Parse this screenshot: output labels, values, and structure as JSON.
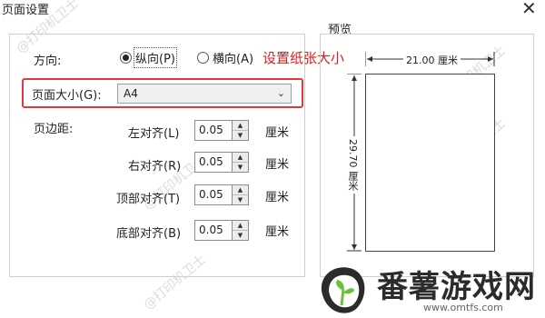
{
  "window": {
    "title": "页面设置"
  },
  "orientation": {
    "label": "方向:",
    "portrait": "纵向(P)",
    "landscape": "横向(A)",
    "selected": "portrait"
  },
  "annotation": "设置纸张大小",
  "page_size": {
    "label": "页面大小(G):",
    "value": "A4"
  },
  "margins": {
    "label": "页边距:",
    "rows": [
      {
        "label": "左对齐(L)",
        "value": "0.05",
        "unit": "厘米"
      },
      {
        "label": "右对齐(R)",
        "value": "0.05",
        "unit": "厘米"
      },
      {
        "label": "顶部对齐(T)",
        "value": "0.05",
        "unit": "厘米"
      },
      {
        "label": "底部对齐(B)",
        "value": "0.05",
        "unit": "厘米"
      }
    ]
  },
  "preview": {
    "label": "预览",
    "width_text": "21.00 厘米",
    "height_text": "29.70 厘米"
  },
  "watermark": "@打印机卫士",
  "branding": {
    "name": "番薯游戏网",
    "url": "www.omtfs.com"
  },
  "colors": {
    "highlight": "#e23a3a",
    "annotation": "#e11b1b"
  }
}
